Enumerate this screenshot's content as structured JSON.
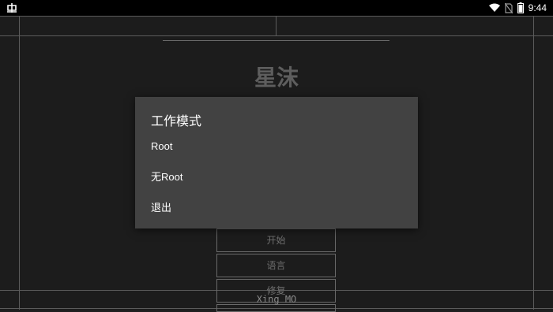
{
  "status_bar": {
    "time": "9:44",
    "app_icon": "bug-icon",
    "icons": [
      "wifi-icon",
      "no-sim-icon",
      "battery-icon"
    ]
  },
  "app": {
    "title": "星沫",
    "buttons": [
      "开始",
      "语言",
      "修复"
    ],
    "footer": "Xing MO"
  },
  "dialog": {
    "title": "工作模式",
    "options": [
      "Root",
      "无Root",
      "退出"
    ]
  }
}
